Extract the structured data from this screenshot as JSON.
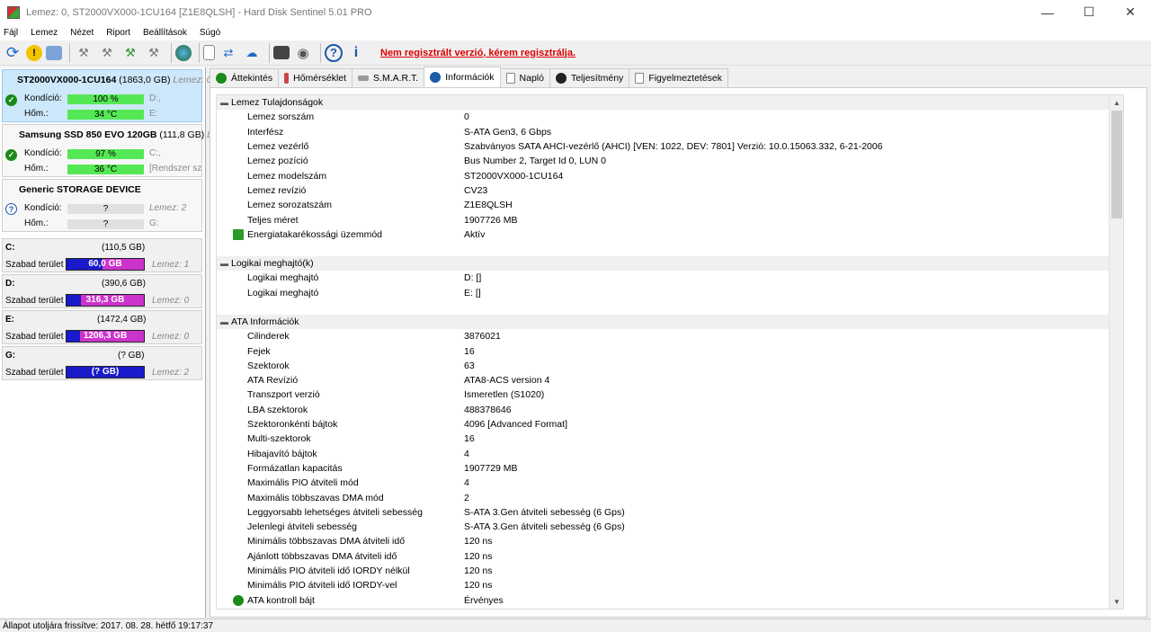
{
  "window": {
    "title": "Lemez: 0, ST2000VX000-1CU164 [Z1E8QLSH]  -  Hard Disk Sentinel 5.01 PRO"
  },
  "menu": [
    "Fájl",
    "Lemez",
    "Nézet",
    "Riport",
    "Beállítások",
    "Súgó"
  ],
  "toolbar": {
    "register_text": "Nem regisztrált verzió, kérem regisztrálja."
  },
  "disks": [
    {
      "name": "ST2000VX000-1CU164",
      "size": "(1863,0 GB)",
      "more": "Lemez: 0",
      "kond_label": "Kondíció:",
      "kond_value": "100 %",
      "kond_level": 100,
      "kond_side": "D:,",
      "hom_label": "Hőm.:",
      "hom_value": "34 °C",
      "hom_side": "E:",
      "status": "ok"
    },
    {
      "name": "Samsung SSD 850 EVO 120GB",
      "size": "(111,8 GB)",
      "more": "Le",
      "kond_label": "Kondíció:",
      "kond_value": "97 %",
      "kond_level": 97,
      "kond_side": "C:,",
      "hom_label": "Hőm.:",
      "hom_value": "36 °C",
      "hom_side": "[Rendszer sz",
      "status": "ok"
    },
    {
      "name": "Generic STORAGE DEVICE",
      "size": "",
      "more": "",
      "kond_label": "Kondíció:",
      "kond_value": "?",
      "kond_level": 0,
      "kond_side": "Lemez: 2",
      "hom_label": "Hőm.:",
      "hom_value": "?",
      "hom_side": "G:",
      "status": "unknown"
    }
  ],
  "volumes": [
    {
      "letter": "C:",
      "size": "(110,5 GB)",
      "free_label": "Szabad terület",
      "free": "60,0 GB",
      "used_fraction": 0.46,
      "disk": "Lemez: 1"
    },
    {
      "letter": "D:",
      "size": "(390,6 GB)",
      "free_label": "Szabad terület",
      "free": "316,3 GB",
      "used_fraction": 0.19,
      "disk": "Lemez: 0"
    },
    {
      "letter": "E:",
      "size": "(1472,4 GB)",
      "free_label": "Szabad terület",
      "free": "1206,3 GB",
      "used_fraction": 0.18,
      "disk": "Lemez: 0"
    },
    {
      "letter": "G:",
      "size": "(? GB)",
      "free_label": "Szabad terület",
      "free": "(? GB)",
      "used_fraction": 1.0,
      "disk": "Lemez: 2"
    }
  ],
  "tabs": [
    {
      "label": "Áttekintés",
      "icon": "check-icon"
    },
    {
      "label": "Hőmérséklet",
      "icon": "thermometer-icon"
    },
    {
      "label": "S.M.A.R.T.",
      "icon": "smart-icon"
    },
    {
      "label": "Információk",
      "icon": "info-icon"
    },
    {
      "label": "Napló",
      "icon": "log-icon"
    },
    {
      "label": "Teljesítmény",
      "icon": "performance-icon"
    },
    {
      "label": "Figyelmeztetések",
      "icon": "alerts-icon"
    }
  ],
  "active_tab": "Információk",
  "sections": [
    {
      "title": "Lemez Tulajdonságok",
      "rows": [
        [
          "Lemez sorszám",
          "0"
        ],
        [
          "Interfész",
          "S-ATA Gen3, 6 Gbps"
        ],
        [
          "Lemez vezérlő",
          "Szabványos SATA AHCI-vezérlő (AHCI) [VEN: 1022, DEV: 7801] Verzió: 10.0.15063.332, 6-21-2006"
        ],
        [
          "Lemez pozíció",
          "Bus Number 2, Target Id 0, LUN 0"
        ],
        [
          "Lemez modelszám",
          "ST2000VX000-1CU164"
        ],
        [
          "Lemez revízió",
          "CV23"
        ],
        [
          "Lemez sorozatszám",
          "Z1E8QLSH"
        ],
        [
          "Teljes méret",
          "1907726 MB"
        ],
        [
          "Energiatakarékossági üzemmód",
          "Aktív"
        ]
      ]
    },
    {
      "title": "Logikai meghajtó(k)",
      "rows": [
        [
          "Logikai meghajtó",
          "D: []"
        ],
        [
          "Logikai meghajtó",
          "E: []"
        ]
      ]
    },
    {
      "title": "ATA Információk",
      "rows": [
        [
          "Cilinderek",
          "3876021"
        ],
        [
          "Fejek",
          "16"
        ],
        [
          "Szektorok",
          "63"
        ],
        [
          "ATA Revízió",
          "ATA8-ACS version 4"
        ],
        [
          "Transzport verzió",
          "Ismeretlen (S1020)"
        ],
        [
          "LBA szektorok",
          "488378646"
        ],
        [
          "Szektoronkénti bájtok",
          "4096 [Advanced Format]"
        ],
        [
          "Multi-szektorok",
          "16"
        ],
        [
          "Hibajavító bájtok",
          "4"
        ],
        [
          "Formázatlan kapacitás",
          "1907729 MB"
        ],
        [
          "Maximális PIO átviteli mód",
          "4"
        ],
        [
          "Maximális többszavas DMA mód",
          "2"
        ],
        [
          "Leggyorsabb lehetséges átviteli sebesség",
          "S-ATA 3.Gen átviteli sebesség (6 Gps)"
        ],
        [
          "Jelenlegi átviteli sebesség",
          "S-ATA 3.Gen átviteli sebesség (6 Gps)"
        ],
        [
          "Minimális többszavas DMA átviteli idő",
          "120 ns"
        ],
        [
          "Ajánlott többszavas DMA átviteli idő",
          "120 ns"
        ],
        [
          "Minimális PIO átviteli idő IORDY nélkül",
          "120 ns"
        ],
        [
          "Minimális PIO átviteli idő IORDY-vel",
          "120 ns"
        ],
        [
          "ATA kontroll bájt",
          "Érvényes"
        ]
      ]
    }
  ],
  "status_bar": "Állapot utoljára frissítve: 2017. 08. 28. hétfő 19:17:37",
  "colors": {
    "register": "#dd0000",
    "volume_free": "#cc33cc",
    "volume_used": "#1a1acc",
    "condition_good": "#55e855"
  }
}
